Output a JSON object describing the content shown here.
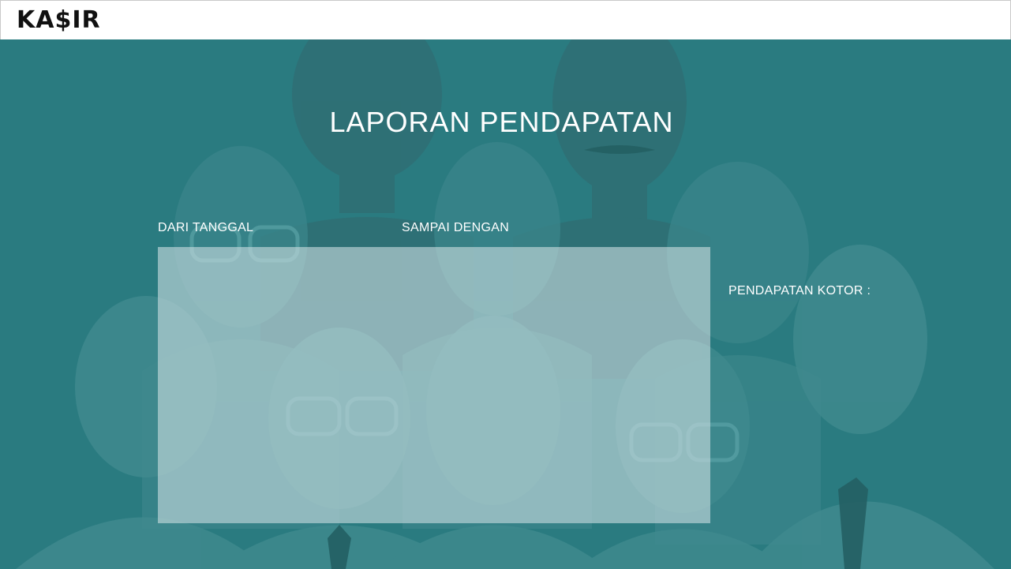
{
  "header": {
    "app_title": "KA$IR"
  },
  "main": {
    "title": "LAPORAN PENDAPATAN",
    "from_date_label": "DARI TANGGAL",
    "to_date_label": "SAMPAI DENGAN",
    "gross_income_label": "PENDAPATAN KOTOR :"
  },
  "colors": {
    "header_bg": "#ffffff",
    "stage_bg": "#2a7b80",
    "panel_bg": "#c8dcde",
    "text": "#ffffff"
  }
}
